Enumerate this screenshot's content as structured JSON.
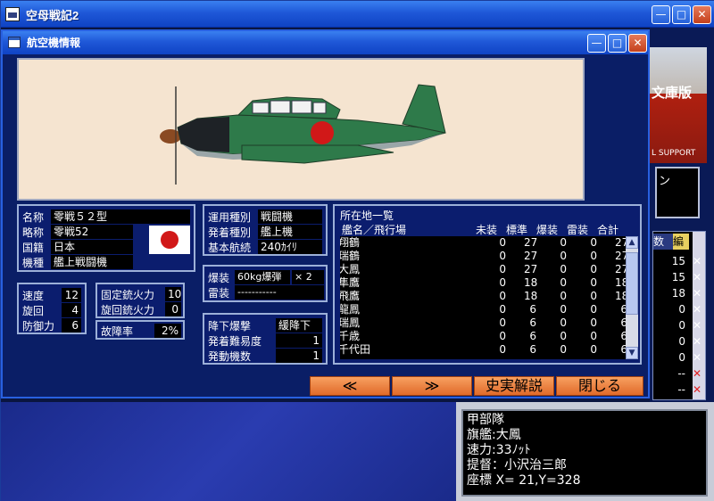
{
  "window": {
    "title": "空母戦記2"
  },
  "background": {
    "banner_text": "文庫版",
    "banner_sub": "L SUPPORT",
    "box_text": "ン",
    "rightlist": {
      "headers": [
        "数",
        "編"
      ],
      "rows": [
        {
          "n": "15",
          "x": "✕",
          "red": false
        },
        {
          "n": "15",
          "x": "✕",
          "red": false
        },
        {
          "n": "18",
          "x": "✕",
          "red": false
        },
        {
          "n": "0",
          "x": "✕",
          "red": false
        },
        {
          "n": "0",
          "x": "✕",
          "red": false
        },
        {
          "n": "0",
          "x": "✕",
          "red": false
        },
        {
          "n": "0",
          "x": "✕",
          "red": false
        },
        {
          "n": "--",
          "x": "✕",
          "red": true
        },
        {
          "n": "--",
          "x": "✕",
          "red": true
        }
      ]
    },
    "info": {
      "lines": [
        "甲部隊",
        "旗艦:大鳳",
        "速力:33ﾉｯﾄ",
        "提督：小沢治三郎",
        "座標 X= 21,Y=328"
      ]
    }
  },
  "dialog": {
    "title": "航空機情報",
    "name": {
      "labels": [
        "名称",
        "略称",
        "国籍",
        "機種"
      ],
      "values": [
        "零戦５２型",
        "零戦52",
        "日本",
        "艦上戦闘機"
      ]
    },
    "usage": {
      "labels": [
        "運用種別",
        "発着種別",
        "基本航続"
      ],
      "values": [
        "戦闘機",
        "艦上機",
        "240ｶｲﾘ"
      ]
    },
    "bomb": {
      "labels": [
        "爆装",
        "雷装"
      ],
      "bomb_value": "60kg爆弾",
      "bomb_count": "× 2",
      "torpedo_value": "-----------"
    },
    "stats": {
      "labels": [
        "速度",
        "旋回",
        "防御力"
      ],
      "values": [
        "12",
        "4",
        "6"
      ]
    },
    "guns": {
      "labels": [
        "固定銃火力",
        "旋回銃火力"
      ],
      "values": [
        "10",
        "0"
      ]
    },
    "failure": {
      "label": "故障率",
      "value": "2%"
    },
    "dive": {
      "labels": [
        "降下爆撃",
        "発着難易度",
        "発動機数"
      ],
      "values": [
        "緩降下",
        "1",
        "1"
      ]
    },
    "location": {
      "title": "所在地一覧",
      "headers": [
        "艦名／飛行場",
        "未装",
        "標準",
        "爆装",
        "雷装",
        "合計"
      ],
      "rows": [
        [
          "翔鶴",
          "0",
          "27",
          "0",
          "0",
          "27"
        ],
        [
          "瑞鶴",
          "0",
          "27",
          "0",
          "0",
          "27"
        ],
        [
          "大鳳",
          "0",
          "27",
          "0",
          "0",
          "27"
        ],
        [
          "隼鷹",
          "0",
          "18",
          "0",
          "0",
          "18"
        ],
        [
          "飛鷹",
          "0",
          "18",
          "0",
          "0",
          "18"
        ],
        [
          "龍鳳",
          "0",
          "6",
          "0",
          "0",
          "6"
        ],
        [
          "瑞鳳",
          "0",
          "6",
          "0",
          "0",
          "6"
        ],
        [
          "千歳",
          "0",
          "6",
          "0",
          "0",
          "6"
        ],
        [
          "千代田",
          "0",
          "6",
          "0",
          "0",
          "6"
        ]
      ]
    },
    "buttons": {
      "prev": "≪",
      "next": "≫",
      "history": "史実解説",
      "close": "閉じる"
    }
  },
  "colors": {
    "title_blue": "#1f58d8",
    "orange_button": "#e06a2a",
    "panel_border": "#9cb0d8"
  }
}
